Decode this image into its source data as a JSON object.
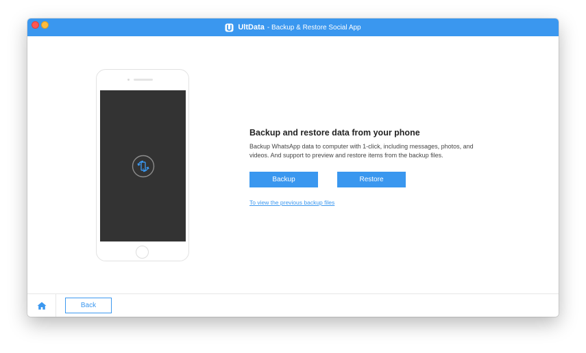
{
  "window": {
    "title_brand": "UltData",
    "title_rest": "- Backup & Restore Social App"
  },
  "icons": {
    "logo": "ultdata-logo-icon",
    "sync": "phone-sync-icon",
    "home": "home-icon"
  },
  "colors": {
    "accent": "#3a97ef",
    "phone_screen": "#333333",
    "close": "#fc5753",
    "minimize": "#fdbc40"
  },
  "main": {
    "heading": "Backup and restore data from your phone",
    "description": "Backup WhatsApp data to computer with 1-click, including messages, photos, and videos. And support to preview and restore items from the backup files.",
    "backup_label": "Backup",
    "restore_label": "Restore",
    "previous_backups_link": "To view the previous backup files"
  },
  "footer": {
    "back_label": "Back"
  }
}
